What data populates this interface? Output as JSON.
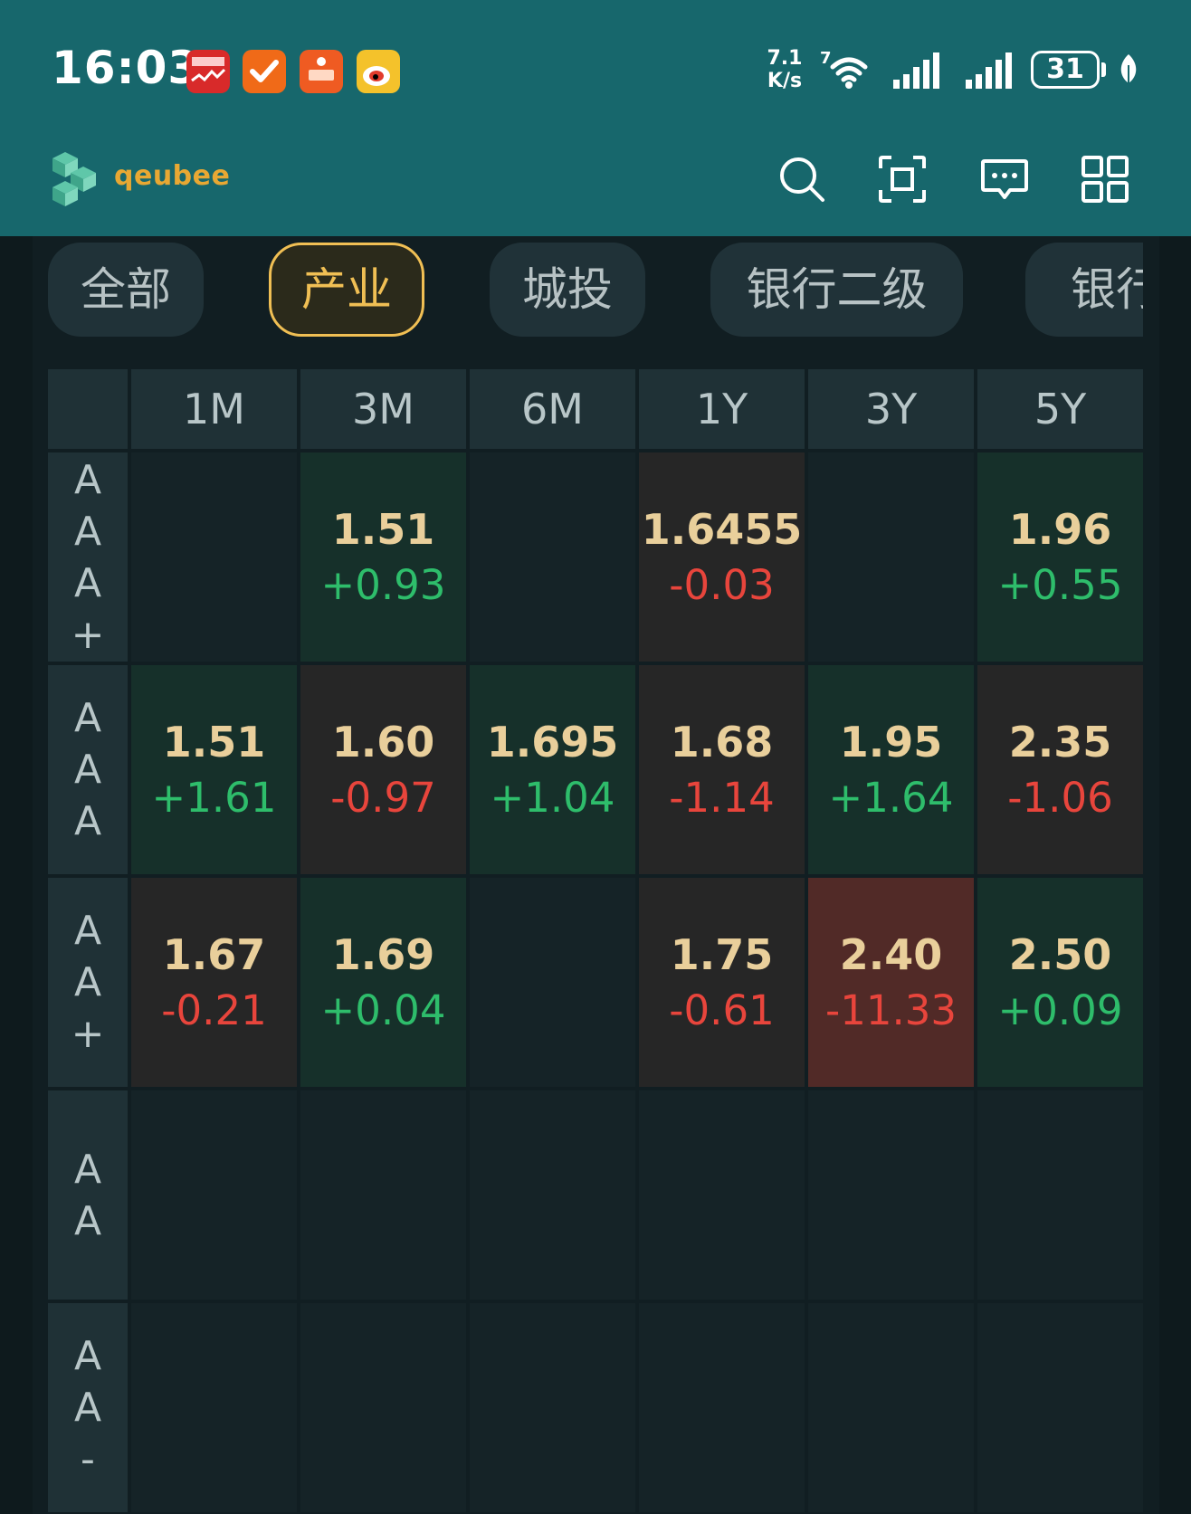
{
  "status_bar": {
    "time": "16:03",
    "notification_icons": [
      "爱股票",
      "check-app",
      "证券",
      "weibo"
    ],
    "net_speed_value": "7.1",
    "net_speed_unit": "K/s",
    "wifi_label": "7",
    "battery": "31"
  },
  "app": {
    "logo_text": "qeubee",
    "header_icons": [
      "search-icon",
      "scan-icon",
      "message-icon",
      "grid-menu-icon"
    ]
  },
  "tabs": [
    {
      "label": "全部",
      "active": false
    },
    {
      "label": "产业",
      "active": true
    },
    {
      "label": "城投",
      "active": false
    },
    {
      "label": "银行二级",
      "active": false
    },
    {
      "label": "银行",
      "active": false
    }
  ],
  "table": {
    "columns": [
      "1M",
      "3M",
      "6M",
      "1Y",
      "3Y",
      "5Y"
    ],
    "rows": [
      {
        "rating": "AAA+",
        "cells": [
          null,
          {
            "value": "1.51",
            "change": "+0.93"
          },
          null,
          {
            "value": "1.6455",
            "change": "-0.03"
          },
          null,
          {
            "value": "1.96",
            "change": "+0.55"
          }
        ]
      },
      {
        "rating": "AAA",
        "cells": [
          {
            "value": "1.51",
            "change": "+1.61"
          },
          {
            "value": "1.60",
            "change": "-0.97"
          },
          {
            "value": "1.695",
            "change": "+1.04"
          },
          {
            "value": "1.68",
            "change": "-1.14"
          },
          {
            "value": "1.95",
            "change": "+1.64"
          },
          {
            "value": "2.35",
            "change": "-1.06"
          }
        ]
      },
      {
        "rating": "AA+",
        "cells": [
          {
            "value": "1.67",
            "change": "-0.21"
          },
          {
            "value": "1.69",
            "change": "+0.04"
          },
          null,
          {
            "value": "1.75",
            "change": "-0.61"
          },
          {
            "value": "2.40",
            "change": "-11.33",
            "highlight": true
          },
          {
            "value": "2.50",
            "change": "+0.09"
          }
        ]
      },
      {
        "rating": "AA",
        "cells": [
          null,
          null,
          null,
          null,
          null,
          null
        ]
      },
      {
        "rating": "AA-",
        "cells": [
          null,
          null,
          null,
          null,
          null,
          null
        ]
      }
    ]
  }
}
